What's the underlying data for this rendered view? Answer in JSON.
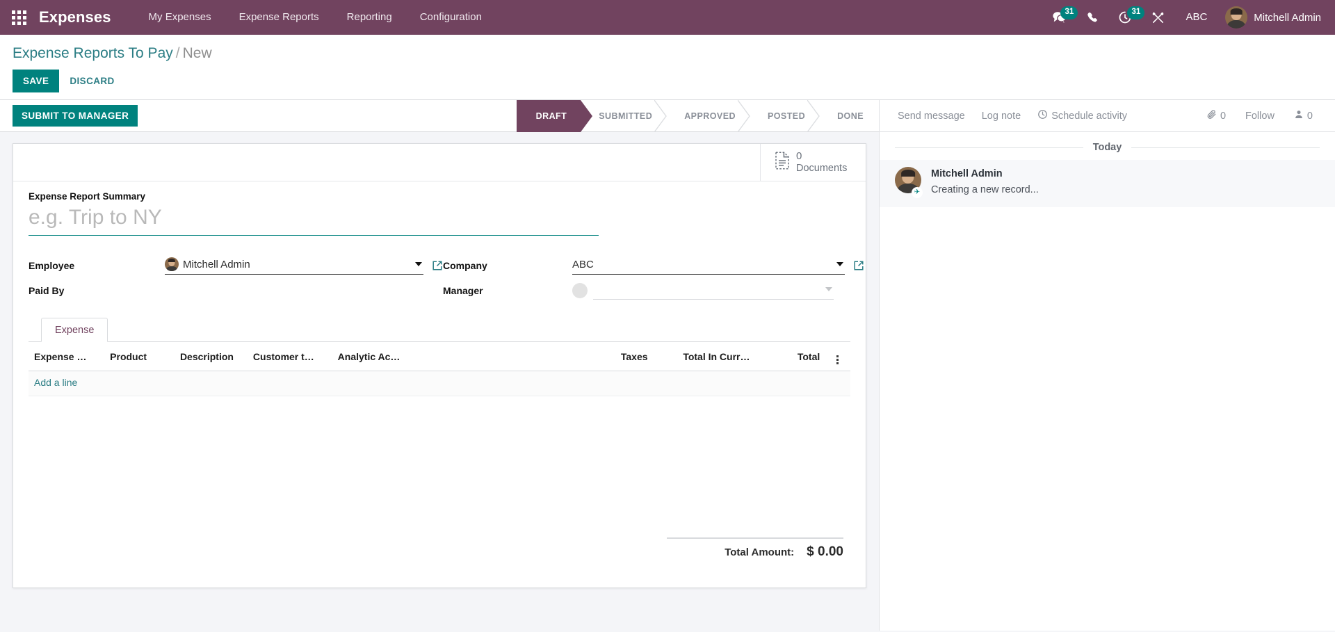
{
  "navbar": {
    "apps_icon": "apps-grid-icon",
    "brand": "Expenses",
    "menu": [
      {
        "label": "My Expenses"
      },
      {
        "label": "Expense Reports"
      },
      {
        "label": "Reporting"
      },
      {
        "label": "Configuration"
      }
    ],
    "systray": {
      "messages_icon": "messages-icon",
      "messages_count": "31",
      "phone_icon": "phone-icon",
      "activities_icon": "clock-icon",
      "activities_count": "31",
      "debug_icon": "tools-icon",
      "company": "ABC",
      "user_name": "Mitchell Admin",
      "user_avatar": "avatar"
    }
  },
  "control_panel": {
    "breadcrumb_root": "Expense Reports To Pay",
    "breadcrumb_sep": "/",
    "breadcrumb_current": "New",
    "save_label": "SAVE",
    "discard_label": "DISCARD"
  },
  "statusbar": {
    "primary_button": "SUBMIT TO MANAGER",
    "stages": [
      {
        "label": "DRAFT",
        "active": true
      },
      {
        "label": "SUBMITTED",
        "active": false
      },
      {
        "label": "APPROVED",
        "active": false
      },
      {
        "label": "POSTED",
        "active": false
      },
      {
        "label": "DONE",
        "active": false
      }
    ]
  },
  "form": {
    "stat_button": {
      "icon": "document-icon",
      "count": "0",
      "label": "Documents"
    },
    "title_field": {
      "label": "Expense Report Summary",
      "value": "",
      "placeholder": "e.g. Trip to NY"
    },
    "fields": {
      "employee_label": "Employee",
      "employee_value": "Mitchell Admin",
      "company_label": "Company",
      "company_value": "ABC",
      "paid_by_label": "Paid By",
      "paid_by_value": "",
      "manager_label": "Manager",
      "manager_value": ""
    },
    "notebook": {
      "tabs": [
        {
          "label": "Expense",
          "active": true
        }
      ],
      "columns": [
        {
          "label": "Expense …",
          "align": "left"
        },
        {
          "label": "Product",
          "align": "left"
        },
        {
          "label": "Description",
          "align": "left"
        },
        {
          "label": "Customer t…",
          "align": "left"
        },
        {
          "label": "Analytic Ac…",
          "align": "left"
        },
        {
          "label": "Taxes",
          "align": "right"
        },
        {
          "label": "Total In Curr…",
          "align": "right"
        },
        {
          "label": "Total",
          "align": "right"
        }
      ],
      "optional_columns_icon": "vertical-dots-icon",
      "add_line_label": "Add a line",
      "rows": []
    },
    "totals": {
      "label": "Total Amount:",
      "value": "$ 0.00"
    }
  },
  "chatter": {
    "send_message": "Send message",
    "log_note": "Log note",
    "schedule_activity": "Schedule activity",
    "schedule_activity_icon": "clock-icon",
    "attachment_icon": "paperclip-icon",
    "attachment_count": "0",
    "follow_label": "Follow",
    "followers_icon": "user-icon",
    "followers_count": "0",
    "day_separator": "Today",
    "messages": [
      {
        "author": "Mitchell Admin",
        "body": "Creating a new record...",
        "avatar": "avatar",
        "badge_icon": "plane-icon"
      }
    ]
  },
  "colors": {
    "brand_purple": "#71435f",
    "accent_teal": "#00827e",
    "link_teal": "#2b7d84",
    "page_bg": "#f4f5f8"
  }
}
